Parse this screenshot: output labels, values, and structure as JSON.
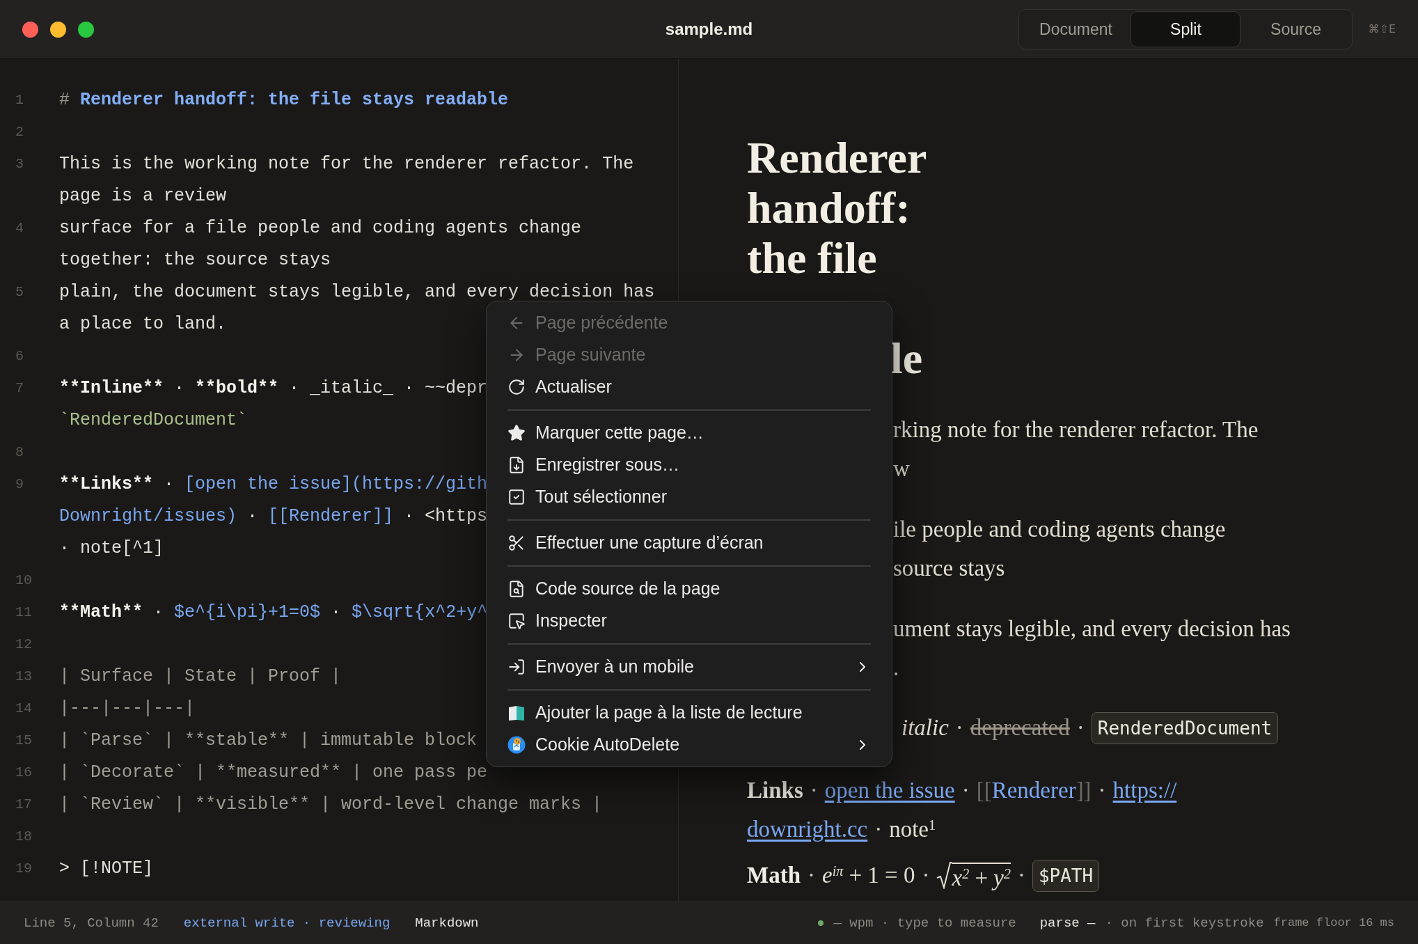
{
  "window": {
    "title": "sample.md",
    "shortcut": "⌘⇧E"
  },
  "view_tabs": [
    {
      "label": "Document",
      "selected": false
    },
    {
      "label": "Split",
      "selected": true
    },
    {
      "label": "Source",
      "selected": false
    }
  ],
  "source_lines": [
    {
      "number": "1",
      "rows": [
        {
          "segments": [
            {
              "kind": "marker",
              "text": "# "
            },
            {
              "kind": "heading",
              "text": "Renderer handoff: the file stays readable"
            }
          ]
        }
      ]
    },
    {
      "number": "2"
    },
    {
      "number": "3",
      "rows": [
        {
          "segments": [
            {
              "kind": "plain",
              "text": "This is the working note for the renderer refactor. The"
            }
          ]
        },
        {
          "segments": [
            {
              "kind": "plain",
              "text": "page is a review"
            }
          ]
        }
      ]
    },
    {
      "number": "4",
      "rows": [
        {
          "segments": [
            {
              "kind": "plain",
              "text": "surface for a file people and coding agents change"
            }
          ]
        },
        {
          "segments": [
            {
              "kind": "plain",
              "text": "together: the source stays"
            }
          ]
        }
      ]
    },
    {
      "number": "5",
      "rows": [
        {
          "segments": [
            {
              "kind": "plain",
              "text": "plain, the document stays legible, and every decision has"
            }
          ]
        },
        {
          "segments": [
            {
              "kind": "plain",
              "text": "a place to land."
            }
          ]
        }
      ]
    },
    {
      "number": "6"
    },
    {
      "number": "7",
      "rows": [
        {
          "segments": [
            {
              "kind": "strong",
              "text": "**Inline**"
            },
            {
              "kind": "plain",
              "text": " · "
            },
            {
              "kind": "strong",
              "text": "**bold**"
            },
            {
              "kind": "plain",
              "text": " · _italic_ · ~~depr"
            }
          ]
        },
        {
          "segments": [
            {
              "kind": "code",
              "text": "`RenderedDocument`"
            }
          ]
        }
      ]
    },
    {
      "number": "8"
    },
    {
      "number": "9",
      "rows": [
        {
          "segments": [
            {
              "kind": "strong",
              "text": "**Links**"
            },
            {
              "kind": "plain",
              "text": " · "
            },
            {
              "kind": "link",
              "text": "[open the issue](https://gith"
            }
          ]
        },
        {
          "segments": [
            {
              "kind": "link",
              "text": "Downright/issues)"
            },
            {
              "kind": "plain",
              "text": " · "
            },
            {
              "kind": "link",
              "text": "[[Renderer]]"
            },
            {
              "kind": "plain",
              "text": " · <https"
            }
          ]
        },
        {
          "segments": [
            {
              "kind": "plain",
              "text": "· note[^1]"
            }
          ]
        }
      ]
    },
    {
      "number": "10"
    },
    {
      "number": "11",
      "rows": [
        {
          "segments": [
            {
              "kind": "strong",
              "text": "**Math**"
            },
            {
              "kind": "plain",
              "text": " · "
            },
            {
              "kind": "math",
              "text": "$e^{i\\pi}+1=0$"
            },
            {
              "kind": "plain",
              "text": " · "
            },
            {
              "kind": "math",
              "text": "$\\sqrt{x^2+y^"
            }
          ]
        }
      ]
    },
    {
      "number": "12"
    },
    {
      "number": "13",
      "rows": [
        {
          "segments": [
            {
              "kind": "table",
              "text": "| Surface | State | Proof |"
            }
          ]
        }
      ]
    },
    {
      "number": "14",
      "rows": [
        {
          "segments": [
            {
              "kind": "table",
              "text": "|---|---|---|"
            }
          ]
        }
      ]
    },
    {
      "number": "15",
      "rows": [
        {
          "segments": [
            {
              "kind": "table",
              "text": "| `Parse` | **stable** | immutable block"
            }
          ]
        }
      ]
    },
    {
      "number": "16",
      "rows": [
        {
          "segments": [
            {
              "kind": "table",
              "text": "| `Decorate` | **measured** | one pass pe"
            }
          ]
        }
      ]
    },
    {
      "number": "17",
      "rows": [
        {
          "segments": [
            {
              "kind": "table",
              "text": "| `Review` | **visible** | word-level change marks |"
            }
          ]
        }
      ]
    },
    {
      "number": "18"
    },
    {
      "number": "19",
      "rows": [
        {
          "segments": [
            {
              "kind": "plain",
              "text": "> [!NOTE]"
            }
          ]
        }
      ]
    }
  ],
  "preview": {
    "heading_lines": [
      "Renderer",
      "handoff:",
      "the file"
    ],
    "heading_tail": "le",
    "paragraphs": [
      [
        "rking note for the renderer refactor. The",
        "w"
      ],
      [
        "ile people and coding agents change",
        "source stays"
      ],
      [
        "ument stays legible, and every decision has",
        "."
      ]
    ],
    "rows": [
      {
        "pieces": [
          {
            "kind": "italic",
            "text": "italic"
          },
          {
            "kind": "dot",
            "text": "·"
          },
          {
            "kind": "strike",
            "text": "deprecated"
          },
          {
            "kind": "dot",
            "text": "·"
          },
          {
            "kind": "code",
            "text": "RenderedDocument"
          }
        ]
      },
      {
        "pieces": [
          {
            "kind": "strong",
            "text": "Links"
          },
          {
            "kind": "dot",
            "text": "·"
          },
          {
            "kind": "link",
            "text": "open the issue"
          },
          {
            "kind": "dot",
            "text": "·"
          },
          {
            "kind": "wiki",
            "open": "[[",
            "text": "Renderer",
            "close": "]]"
          },
          {
            "kind": "dot",
            "text": "·"
          },
          {
            "kind": "link",
            "text": "https://"
          }
        ]
      },
      {
        "pieces": [
          {
            "kind": "link",
            "text": "downright.cc"
          },
          {
            "kind": "dot",
            "text": "·"
          },
          {
            "kind": "note",
            "text": "note$^{1}$"
          }
        ]
      },
      {
        "pieces": [
          {
            "kind": "strong",
            "text": "Math"
          },
          {
            "kind": "dot",
            "text": "·"
          },
          {
            "kind": "math",
            "text": "*e*$^{iπ}$ + 1 = 0"
          },
          {
            "kind": "dot",
            "text": "·"
          },
          {
            "kind": "radical",
            "text": "*x*$^{2}$ + *y*$^{2}$"
          },
          {
            "kind": "dot",
            "text": "·"
          },
          {
            "kind": "code",
            "text": "$PATH"
          }
        ]
      }
    ]
  },
  "context_menu": {
    "sections": [
      [
        {
          "label": "Page précédente",
          "disabled": true,
          "submenu": false
        },
        {
          "label": "Page suivante",
          "disabled": true,
          "submenu": false
        },
        {
          "label": "Actualiser",
          "disabled": false,
          "submenu": false
        }
      ],
      [
        {
          "label": "Marquer cette page…",
          "disabled": false,
          "submenu": false
        },
        {
          "label": "Enregistrer sous…",
          "disabled": false,
          "submenu": false
        },
        {
          "label": "Tout sélectionner",
          "disabled": false,
          "submenu": false
        }
      ],
      [
        {
          "label": "Effectuer une capture d’écran",
          "disabled": false,
          "submenu": false
        }
      ],
      [
        {
          "label": "Code source de la page",
          "disabled": false,
          "submenu": false
        },
        {
          "label": "Inspecter",
          "disabled": false,
          "submenu": false
        }
      ],
      [
        {
          "label": "Envoyer à un mobile",
          "disabled": false,
          "submenu": true
        }
      ],
      [
        {
          "label": "Ajouter la page à la liste de lecture",
          "disabled": false,
          "submenu": false
        },
        {
          "label": "Cookie AutoDelete",
          "disabled": false,
          "submenu": true
        }
      ]
    ]
  },
  "status_bar": {
    "left": [
      {
        "kind": "muted",
        "text": "Line 5, Column 42"
      },
      {
        "kind": "accent",
        "text": "external write · reviewing"
      },
      {
        "kind": "plain",
        "text": "Markdown"
      }
    ],
    "right": [
      {
        "kind": "muted",
        "text": "— wpm · type to measure"
      },
      {
        "kind": "plain",
        "text": "parse —"
      },
      {
        "kind": "muted",
        "text": "· on first keystroke"
      },
      {
        "kind": "small",
        "text": "frame floor 16 ms"
      }
    ]
  }
}
